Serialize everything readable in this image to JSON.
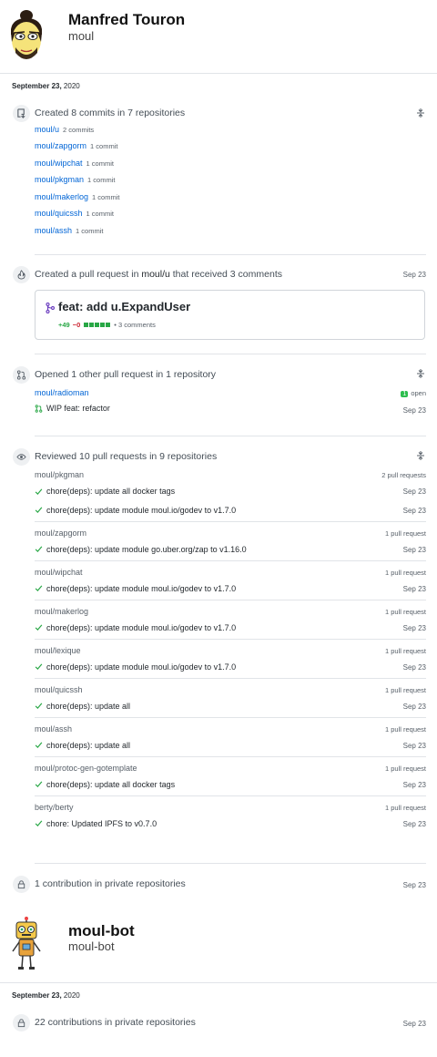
{
  "users": [
    {
      "name": "Manfred Touron",
      "login": "moul",
      "date_month_day": "September 23,",
      "date_year": " 2020",
      "commits": {
        "heading": "Created 8 commits in 7 repositories",
        "repos": [
          {
            "name": "moul/u",
            "count": "2 commits"
          },
          {
            "name": "moul/zapgorm",
            "count": "1 commit"
          },
          {
            "name": "moul/wipchat",
            "count": "1 commit"
          },
          {
            "name": "moul/pkgman",
            "count": "1 commit"
          },
          {
            "name": "moul/makerlog",
            "count": "1 commit"
          },
          {
            "name": "moul/quicssh",
            "count": "1 commit"
          },
          {
            "name": "moul/assh",
            "count": "1 commit"
          }
        ]
      },
      "pull_request": {
        "heading_prefix": "Created a pull request in ",
        "repo": "moul/u",
        "heading_suffix": " that received 3 comments",
        "date": "Sep 23",
        "title": "feat: add u.ExpandUser",
        "additions": "+49",
        "deletions": "−0",
        "comments": "• 3 comments"
      },
      "opened_pr": {
        "heading": "Opened 1 other pull request in 1 repository",
        "repo": "moul/radioman",
        "open_count": "1",
        "open_label": "open",
        "pr_title": "WIP feat: refactor",
        "date": "Sep 23"
      },
      "reviews": {
        "heading": "Reviewed 10 pull requests in 9 repositories",
        "groups": [
          {
            "repo": "moul/pkgman",
            "count": "2 pull requests",
            "items": [
              {
                "title": "chore(deps): update all docker tags",
                "date": "Sep 23"
              },
              {
                "title": "chore(deps): update module moul.io/godev to v1.7.0",
                "date": "Sep 23"
              }
            ]
          },
          {
            "repo": "moul/zapgorm",
            "count": "1 pull request",
            "items": [
              {
                "title": "chore(deps): update module go.uber.org/zap to v1.16.0",
                "date": "Sep 23"
              }
            ]
          },
          {
            "repo": "moul/wipchat",
            "count": "1 pull request",
            "items": [
              {
                "title": "chore(deps): update module moul.io/godev to v1.7.0",
                "date": "Sep 23"
              }
            ]
          },
          {
            "repo": "moul/makerlog",
            "count": "1 pull request",
            "items": [
              {
                "title": "chore(deps): update module moul.io/godev to v1.7.0",
                "date": "Sep 23"
              }
            ]
          },
          {
            "repo": "moul/lexique",
            "count": "1 pull request",
            "items": [
              {
                "title": "chore(deps): update module moul.io/godev to v1.7.0",
                "date": "Sep 23"
              }
            ]
          },
          {
            "repo": "moul/quicssh",
            "count": "1 pull request",
            "items": [
              {
                "title": "chore(deps): update all",
                "date": "Sep 23"
              }
            ]
          },
          {
            "repo": "moul/assh",
            "count": "1 pull request",
            "items": [
              {
                "title": "chore(deps): update all",
                "date": "Sep 23"
              }
            ]
          },
          {
            "repo": "moul/protoc-gen-gotemplate",
            "count": "1 pull request",
            "items": [
              {
                "title": "chore(deps): update all docker tags",
                "date": "Sep 23"
              }
            ]
          },
          {
            "repo": "berty/berty",
            "count": "1 pull request",
            "items": [
              {
                "title": "chore: Updated IPFS to v0.7.0",
                "date": "Sep 23"
              }
            ]
          }
        ]
      },
      "private": {
        "heading": "1 contribution in private repositories",
        "date": "Sep 23"
      }
    },
    {
      "name": "moul-bot",
      "login": "moul-bot",
      "date_month_day": "September 23,",
      "date_year": " 2020",
      "private": {
        "heading": "22 contributions in private repositories",
        "date": "Sep 23"
      }
    }
  ],
  "icons": {
    "commit": "repo-push-icon",
    "flame": "flame-icon",
    "pr": "git-pull-request-icon",
    "eye": "eye-icon",
    "lock": "lock-icon",
    "fold": "fold-icon",
    "check": "check-icon",
    "merged": "git-merge-icon"
  },
  "colors": {
    "link": "#0366d6",
    "green": "#28a745",
    "red": "#cb2431",
    "merged": "#6f42c1"
  }
}
